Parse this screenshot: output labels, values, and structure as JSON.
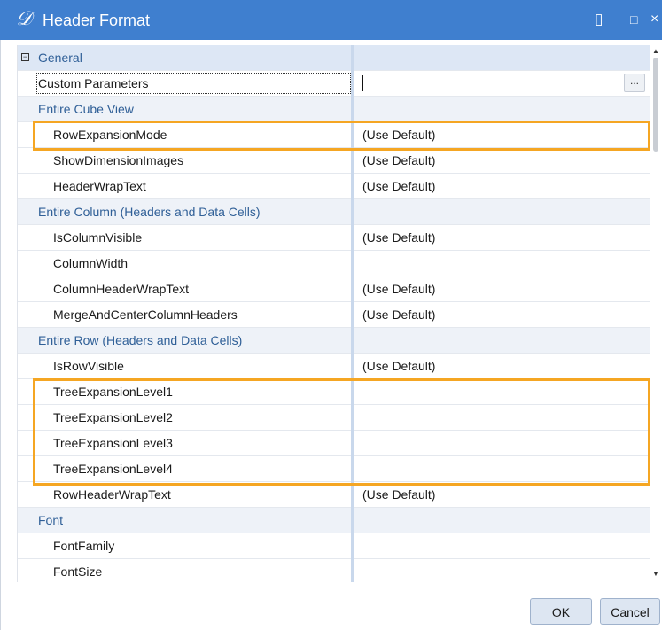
{
  "window": {
    "title": "Header Format",
    "icons": [
      "logo-icon",
      "clipboard-icon",
      "maximize-icon",
      "close-icon"
    ]
  },
  "grid": {
    "rows": [
      {
        "type": "first",
        "name": "General",
        "value": ""
      },
      {
        "type": "prop",
        "name": "Custom Parameters",
        "value": ""
      },
      {
        "type": "category",
        "name": "Entire Cube View",
        "value": ""
      },
      {
        "type": "prop",
        "name": "RowExpansionMode",
        "value": "(Use Default)"
      },
      {
        "type": "prop",
        "name": "ShowDimensionImages",
        "value": "(Use Default)"
      },
      {
        "type": "prop",
        "name": "HeaderWrapText",
        "value": "(Use Default)"
      },
      {
        "type": "category",
        "name": "Entire Column (Headers and Data Cells)",
        "value": ""
      },
      {
        "type": "prop",
        "name": "IsColumnVisible",
        "value": "(Use Default)"
      },
      {
        "type": "prop",
        "name": "ColumnWidth",
        "value": ""
      },
      {
        "type": "prop",
        "name": "ColumnHeaderWrapText",
        "value": "(Use Default)"
      },
      {
        "type": "prop",
        "name": "MergeAndCenterColumnHeaders",
        "value": "(Use Default)"
      },
      {
        "type": "category",
        "name": "Entire Row (Headers and Data Cells)",
        "value": ""
      },
      {
        "type": "prop",
        "name": "IsRowVisible",
        "value": "(Use Default)"
      },
      {
        "type": "prop",
        "name": "TreeExpansionLevel1",
        "value": ""
      },
      {
        "type": "prop",
        "name": "TreeExpansionLevel2",
        "value": ""
      },
      {
        "type": "prop",
        "name": "TreeExpansionLevel3",
        "value": ""
      },
      {
        "type": "prop",
        "name": "TreeExpansionLevel4",
        "value": ""
      },
      {
        "type": "prop",
        "name": "RowHeaderWrapText",
        "value": "(Use Default)"
      },
      {
        "type": "category",
        "name": "Font",
        "value": ""
      },
      {
        "type": "prop",
        "name": "FontFamily",
        "value": ""
      },
      {
        "type": "prop",
        "name": "FontSize",
        "value": ""
      }
    ],
    "ellipsis_label": "..."
  },
  "buttons": {
    "ok": "OK",
    "cancel": "Cancel"
  },
  "colors": {
    "titlebar": "#3f7fcf",
    "highlight": "#f5a623",
    "category_text": "#2f5f97"
  }
}
